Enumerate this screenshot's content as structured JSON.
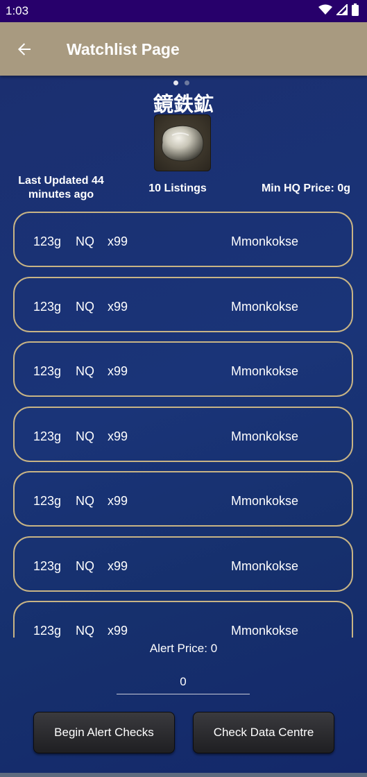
{
  "status_bar": {
    "time": "1:03",
    "icons": [
      "wifi-icon",
      "signal-icon",
      "battery-icon"
    ]
  },
  "app_bar": {
    "title": "Watchlist Page",
    "back_icon": "arrow-left-icon"
  },
  "pager": {
    "count": 2,
    "active": 0
  },
  "item": {
    "name": "鏡鉄鉱",
    "icon": "ore-icon"
  },
  "info": {
    "last_updated_line1": "Last Updated 44",
    "last_updated_line2": "minutes ago",
    "listings": "10 Listings",
    "min_hq": "Min HQ Price: 0g"
  },
  "listings": [
    {
      "price": "123g",
      "quality": "NQ",
      "quantity": "x99",
      "seller": "Mmonkokse"
    },
    {
      "price": "123g",
      "quality": "NQ",
      "quantity": "x99",
      "seller": "Mmonkokse"
    },
    {
      "price": "123g",
      "quality": "NQ",
      "quantity": "x99",
      "seller": "Mmonkokse"
    },
    {
      "price": "123g",
      "quality": "NQ",
      "quantity": "x99",
      "seller": "Mmonkokse"
    },
    {
      "price": "123g",
      "quality": "NQ",
      "quantity": "x99",
      "seller": "Mmonkokse"
    },
    {
      "price": "123g",
      "quality": "NQ",
      "quantity": "x99",
      "seller": "Mmonkokse"
    },
    {
      "price": "123g",
      "quality": "NQ",
      "quantity": "x99",
      "seller": "Mmonkokse"
    }
  ],
  "alert": {
    "label": "Alert Price: 0",
    "input_value": "0"
  },
  "buttons": {
    "begin": "Begin Alert Checks",
    "check": "Check Data Centre"
  },
  "colors": {
    "status_bar": "#27006b",
    "app_bar": "#a89a80",
    "card_border": "#c8b485",
    "background": "#1a3478"
  }
}
